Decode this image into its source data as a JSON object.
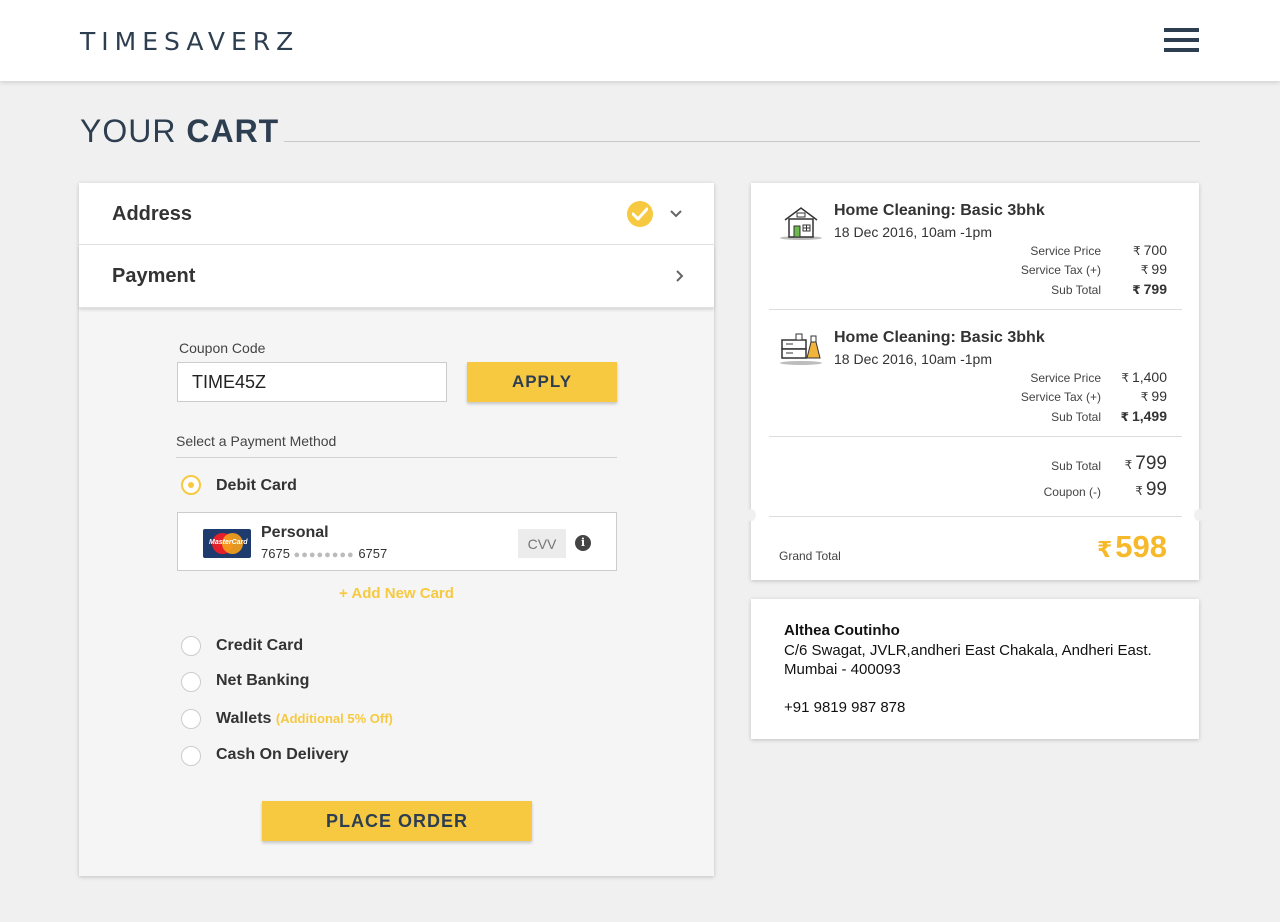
{
  "header": {
    "logo": "TIMESAVERZ",
    "menu_icon": "hamburger-menu-icon"
  },
  "page": {
    "title_light": "YOUR",
    "title_bold": "CART"
  },
  "accordion": {
    "address_label": "Address",
    "payment_label": "Payment"
  },
  "coupon": {
    "label": "Coupon Code",
    "value": "TIME45Z",
    "apply_label": "APPLY"
  },
  "payment": {
    "section_label": "Select a Payment Method",
    "methods": [
      {
        "label": "Debit Card",
        "selected": true
      },
      {
        "label": "Credit Card",
        "selected": false
      },
      {
        "label": "Net Banking",
        "selected": false
      },
      {
        "label": "Wallets",
        "promo": "(Additional 5% Off)",
        "selected": false
      },
      {
        "label": "Cash On Delivery",
        "selected": false
      }
    ],
    "saved_card": {
      "name": "Personal",
      "number_start": "7675",
      "number_mask": "●●●●●●●●",
      "number_end": "6757",
      "cvv_placeholder": "CVV",
      "brand_text": "MasterCard"
    },
    "add_card_label": "+ Add New Card",
    "place_order_label": "PLACE ORDER"
  },
  "summary": {
    "currency": "₹",
    "items": [
      {
        "title": "Home Cleaning: Basic 3bhk",
        "date": "18 Dec 2016, 10am -1pm",
        "icon": "house-cleaning-icon",
        "service_price_label": "Service Price",
        "service_price": "700",
        "service_tax_label": "Service Tax (+)",
        "service_tax": "99",
        "subtotal_label": "Sub Total",
        "subtotal": "799"
      },
      {
        "title": "Home Cleaning: Basic 3bhk",
        "date": "18 Dec 2016, 10am -1pm",
        "icon": "appliance-cleaning-icon",
        "service_price_label": "Service Price",
        "service_price": "1,400",
        "service_tax_label": "Service Tax (+)",
        "service_tax": "99",
        "subtotal_label": "Sub Total",
        "subtotal": "1,499"
      }
    ],
    "subtotal_label": "Sub Total",
    "subtotal": "799",
    "coupon_label": "Coupon (-)",
    "coupon": "99",
    "grand_total_label": "Grand Total",
    "grand_total": "598"
  },
  "address": {
    "name": "Althea Coutinho",
    "line": "C/6 Swagat, JVLR,andheri East Chakala, Andheri East. Mumbai - 400093",
    "phone": "+91 9819 987 878"
  },
  "colors": {
    "accent": "#f7c940",
    "brand": "#2d3e50",
    "grand_total": "#f7b92c"
  }
}
